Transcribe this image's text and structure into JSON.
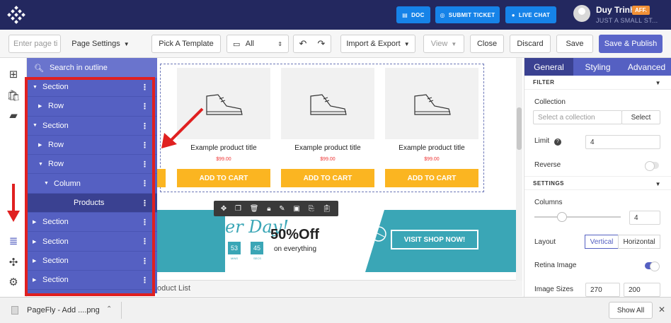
{
  "colors": {
    "topbar": "#23285f",
    "accent": "#5560c2",
    "button_blue": "#1683e8",
    "cart": "#fbb521",
    "banner": "#3aa6b6",
    "annotation_red": "#e02020"
  },
  "header": {
    "buttons": [
      {
        "label": "DOC",
        "icon": "document-icon"
      },
      {
        "label": "SUBMIT TICKET",
        "icon": "lifebuoy-icon"
      },
      {
        "label": "LIVE CHAT",
        "icon": "chat-icon"
      }
    ],
    "user_name": "Duy Trinh",
    "badge": "AFF.",
    "user_sub": "JUST A SMALL ST..."
  },
  "toolbar": {
    "page_title_placeholder": "Enter page ti",
    "page_settings": "Page Settings",
    "pick_template": "Pick A Template",
    "device": "All",
    "import_export": "Import & Export",
    "view": "View",
    "close": "Close",
    "discard": "Discard",
    "save": "Save",
    "save_publish": "Save & Publish"
  },
  "outline": {
    "search_placeholder": "Search in outline",
    "items": [
      {
        "label": "Section",
        "level": 0,
        "expanded": true
      },
      {
        "label": "Row",
        "level": 1,
        "expanded": false
      },
      {
        "label": "Section",
        "level": 0,
        "expanded": true
      },
      {
        "label": "Row",
        "level": 1,
        "expanded": false
      },
      {
        "label": "Row",
        "level": 1,
        "expanded": true
      },
      {
        "label": "Column",
        "level": 2,
        "expanded": true
      },
      {
        "label": "Products",
        "level": 3,
        "expanded": null
      },
      {
        "label": "Section",
        "level": 0,
        "expanded": false
      },
      {
        "label": "Section",
        "level": 0,
        "expanded": false
      },
      {
        "label": "Section",
        "level": 0,
        "expanded": false
      },
      {
        "label": "Section",
        "level": 0,
        "expanded": false
      }
    ]
  },
  "products": [
    {
      "title": "Example product title",
      "price": "$99.00",
      "button": "ADD TO CART"
    },
    {
      "title": "Example product title",
      "price": "$99.00",
      "button": "ADD TO CART"
    },
    {
      "title": "Example product title",
      "price": "$99.00",
      "button": "ADD TO CART"
    }
  ],
  "banner": {
    "day_text": "er Day!",
    "timer_values": [
      "53",
      "45"
    ],
    "timer_labels": [
      "MINS",
      "SECS"
    ],
    "sale": "50%Off",
    "sale_sub": "on everything",
    "cta": "VISIT SHOP NOW!"
  },
  "breadcrumb": "oduct List",
  "right_panel": {
    "tabs": [
      "General",
      "Styling",
      "Advanced"
    ],
    "filter_header": "FILTER",
    "collection_label": "Collection",
    "collection_placeholder": "Select a collection",
    "select_button": "Select",
    "limit_label": "Limit",
    "limit_value": "4",
    "reverse_label": "Reverse",
    "reverse_on": false,
    "settings_header": "SETTINGS",
    "columns_label": "Columns",
    "columns_value": "4",
    "layout_label": "Layout",
    "layout_options": [
      "Vertical",
      "Horizontal"
    ],
    "layout_selected": "Vertical",
    "retina_label": "Retina Image",
    "retina_on": true,
    "image_sizes_label": "Image Sizes",
    "image_width": "270",
    "image_height": "200"
  },
  "download_bar": {
    "file_name": "PageFly - Add ....png",
    "show_all": "Show All"
  }
}
